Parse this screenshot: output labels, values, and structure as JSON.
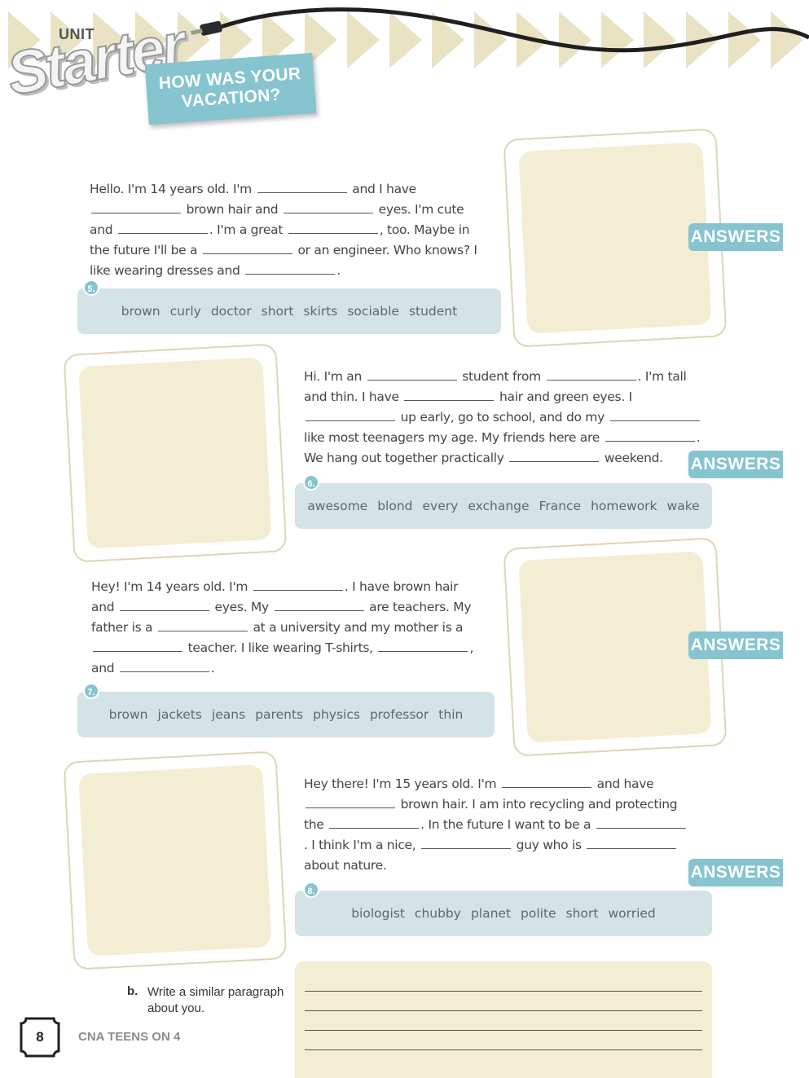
{
  "header": {
    "unit_label": "UNIT",
    "unit_name": "Starter",
    "title_line1": "HOW WAS YOUR",
    "title_line2": "VACATION?"
  },
  "answers_label": "ANSWERS",
  "exercises": [
    {
      "number": "5.",
      "segments": [
        "Hello. I'm 14 years old. I'm",
        "and I have",
        "brown hair and",
        "eyes. I'm cute and",
        ". I'm a great",
        ", too. Maybe in the future I'll be a",
        "or an engineer. Who knows? I like wearing dresses and",
        "."
      ],
      "words": [
        "brown",
        "curly",
        "doctor",
        "short",
        "skirts",
        "sociable",
        "student"
      ]
    },
    {
      "number": "6.",
      "segments": [
        "Hi. I'm an",
        "student from",
        ". I'm tall and thin. I have",
        "hair and green eyes. I",
        "up early, go to school, and do my",
        "like most teenagers my age. My friends here are",
        ". We hang out together practically",
        "weekend."
      ],
      "words": [
        "awesome",
        "blond",
        "every",
        "exchange",
        "France",
        "homework",
        "wake"
      ]
    },
    {
      "number": "7.",
      "segments": [
        "Hey! I'm 14 years old. I'm",
        ". I have brown hair and",
        "eyes. My",
        "are teachers. My father is a",
        "at a university and my mother is a",
        "teacher. I like wearing T-shirts,",
        ", and",
        "."
      ],
      "words": [
        "brown",
        "jackets",
        "jeans",
        "parents",
        "physics",
        "professor",
        "thin"
      ]
    },
    {
      "number": "8.",
      "segments": [
        "Hey there! I'm 15 years old. I'm",
        "and have",
        "brown hair. I am into recycling and protecting the",
        ". In the future I want to be a",
        ". I think I'm a nice,",
        "guy who is",
        "about nature."
      ],
      "words": [
        "biologist",
        "chubby",
        "planet",
        "polite",
        "short",
        "worried"
      ]
    }
  ],
  "task": {
    "letter": "b.",
    "text": "Write a similar paragraph about you."
  },
  "footer": {
    "page_number": "8",
    "book_title": "CNA TEENS ON 4"
  }
}
